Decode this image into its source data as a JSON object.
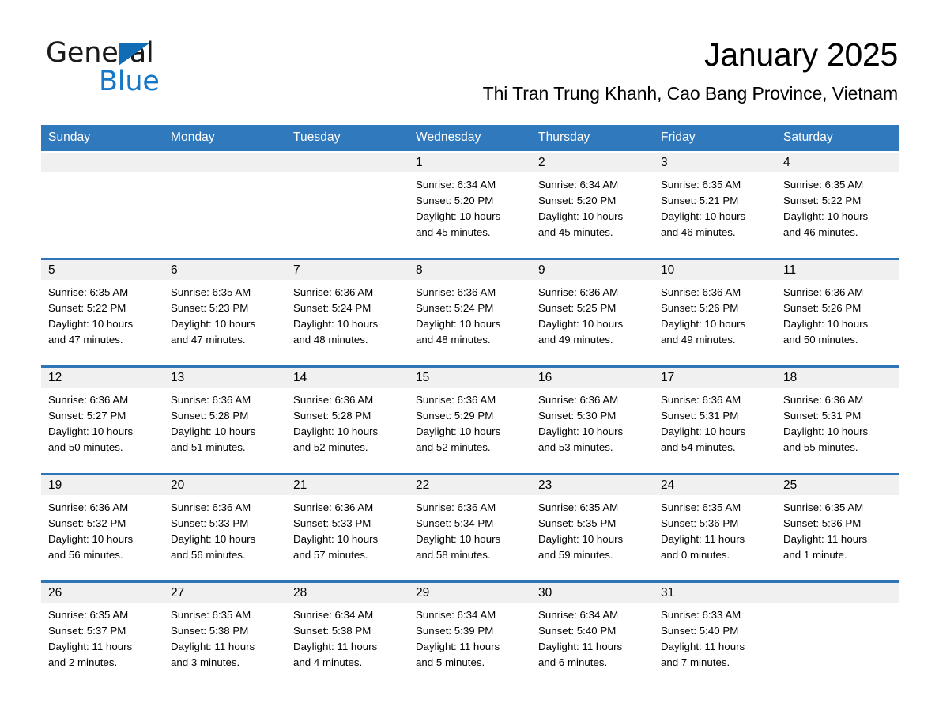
{
  "logo": {
    "word_black": "General",
    "word_blue": "Blue",
    "triangle_color": "#0f6cb5",
    "blue_color": "#1577c8"
  },
  "header": {
    "title": "January 2025",
    "subtitle": "Thi Tran Trung Khanh, Cao Bang Province, Vietnam",
    "accent_color": "#2e75b6",
    "header_band_color": "#3079bd",
    "day_band_color": "#f0f0f0"
  },
  "weekdays": [
    "Sunday",
    "Monday",
    "Tuesday",
    "Wednesday",
    "Thursday",
    "Friday",
    "Saturday"
  ],
  "weeks": [
    [
      {
        "day": "",
        "lines": []
      },
      {
        "day": "",
        "lines": []
      },
      {
        "day": "",
        "lines": []
      },
      {
        "day": "1",
        "lines": [
          "Sunrise: 6:34 AM",
          "Sunset: 5:20 PM",
          "Daylight: 10 hours",
          "and 45 minutes."
        ]
      },
      {
        "day": "2",
        "lines": [
          "Sunrise: 6:34 AM",
          "Sunset: 5:20 PM",
          "Daylight: 10 hours",
          "and 45 minutes."
        ]
      },
      {
        "day": "3",
        "lines": [
          "Sunrise: 6:35 AM",
          "Sunset: 5:21 PM",
          "Daylight: 10 hours",
          "and 46 minutes."
        ]
      },
      {
        "day": "4",
        "lines": [
          "Sunrise: 6:35 AM",
          "Sunset: 5:22 PM",
          "Daylight: 10 hours",
          "and 46 minutes."
        ]
      }
    ],
    [
      {
        "day": "5",
        "lines": [
          "Sunrise: 6:35 AM",
          "Sunset: 5:22 PM",
          "Daylight: 10 hours",
          "and 47 minutes."
        ]
      },
      {
        "day": "6",
        "lines": [
          "Sunrise: 6:35 AM",
          "Sunset: 5:23 PM",
          "Daylight: 10 hours",
          "and 47 minutes."
        ]
      },
      {
        "day": "7",
        "lines": [
          "Sunrise: 6:36 AM",
          "Sunset: 5:24 PM",
          "Daylight: 10 hours",
          "and 48 minutes."
        ]
      },
      {
        "day": "8",
        "lines": [
          "Sunrise: 6:36 AM",
          "Sunset: 5:24 PM",
          "Daylight: 10 hours",
          "and 48 minutes."
        ]
      },
      {
        "day": "9",
        "lines": [
          "Sunrise: 6:36 AM",
          "Sunset: 5:25 PM",
          "Daylight: 10 hours",
          "and 49 minutes."
        ]
      },
      {
        "day": "10",
        "lines": [
          "Sunrise: 6:36 AM",
          "Sunset: 5:26 PM",
          "Daylight: 10 hours",
          "and 49 minutes."
        ]
      },
      {
        "day": "11",
        "lines": [
          "Sunrise: 6:36 AM",
          "Sunset: 5:26 PM",
          "Daylight: 10 hours",
          "and 50 minutes."
        ]
      }
    ],
    [
      {
        "day": "12",
        "lines": [
          "Sunrise: 6:36 AM",
          "Sunset: 5:27 PM",
          "Daylight: 10 hours",
          "and 50 minutes."
        ]
      },
      {
        "day": "13",
        "lines": [
          "Sunrise: 6:36 AM",
          "Sunset: 5:28 PM",
          "Daylight: 10 hours",
          "and 51 minutes."
        ]
      },
      {
        "day": "14",
        "lines": [
          "Sunrise: 6:36 AM",
          "Sunset: 5:28 PM",
          "Daylight: 10 hours",
          "and 52 minutes."
        ]
      },
      {
        "day": "15",
        "lines": [
          "Sunrise: 6:36 AM",
          "Sunset: 5:29 PM",
          "Daylight: 10 hours",
          "and 52 minutes."
        ]
      },
      {
        "day": "16",
        "lines": [
          "Sunrise: 6:36 AM",
          "Sunset: 5:30 PM",
          "Daylight: 10 hours",
          "and 53 minutes."
        ]
      },
      {
        "day": "17",
        "lines": [
          "Sunrise: 6:36 AM",
          "Sunset: 5:31 PM",
          "Daylight: 10 hours",
          "and 54 minutes."
        ]
      },
      {
        "day": "18",
        "lines": [
          "Sunrise: 6:36 AM",
          "Sunset: 5:31 PM",
          "Daylight: 10 hours",
          "and 55 minutes."
        ]
      }
    ],
    [
      {
        "day": "19",
        "lines": [
          "Sunrise: 6:36 AM",
          "Sunset: 5:32 PM",
          "Daylight: 10 hours",
          "and 56 minutes."
        ]
      },
      {
        "day": "20",
        "lines": [
          "Sunrise: 6:36 AM",
          "Sunset: 5:33 PM",
          "Daylight: 10 hours",
          "and 56 minutes."
        ]
      },
      {
        "day": "21",
        "lines": [
          "Sunrise: 6:36 AM",
          "Sunset: 5:33 PM",
          "Daylight: 10 hours",
          "and 57 minutes."
        ]
      },
      {
        "day": "22",
        "lines": [
          "Sunrise: 6:36 AM",
          "Sunset: 5:34 PM",
          "Daylight: 10 hours",
          "and 58 minutes."
        ]
      },
      {
        "day": "23",
        "lines": [
          "Sunrise: 6:35 AM",
          "Sunset: 5:35 PM",
          "Daylight: 10 hours",
          "and 59 minutes."
        ]
      },
      {
        "day": "24",
        "lines": [
          "Sunrise: 6:35 AM",
          "Sunset: 5:36 PM",
          "Daylight: 11 hours",
          "and 0 minutes."
        ]
      },
      {
        "day": "25",
        "lines": [
          "Sunrise: 6:35 AM",
          "Sunset: 5:36 PM",
          "Daylight: 11 hours",
          "and 1 minute."
        ]
      }
    ],
    [
      {
        "day": "26",
        "lines": [
          "Sunrise: 6:35 AM",
          "Sunset: 5:37 PM",
          "Daylight: 11 hours",
          "and 2 minutes."
        ]
      },
      {
        "day": "27",
        "lines": [
          "Sunrise: 6:35 AM",
          "Sunset: 5:38 PM",
          "Daylight: 11 hours",
          "and 3 minutes."
        ]
      },
      {
        "day": "28",
        "lines": [
          "Sunrise: 6:34 AM",
          "Sunset: 5:38 PM",
          "Daylight: 11 hours",
          "and 4 minutes."
        ]
      },
      {
        "day": "29",
        "lines": [
          "Sunrise: 6:34 AM",
          "Sunset: 5:39 PM",
          "Daylight: 11 hours",
          "and 5 minutes."
        ]
      },
      {
        "day": "30",
        "lines": [
          "Sunrise: 6:34 AM",
          "Sunset: 5:40 PM",
          "Daylight: 11 hours",
          "and 6 minutes."
        ]
      },
      {
        "day": "31",
        "lines": [
          "Sunrise: 6:33 AM",
          "Sunset: 5:40 PM",
          "Daylight: 11 hours",
          "and 7 minutes."
        ]
      },
      {
        "day": "",
        "lines": []
      }
    ]
  ]
}
